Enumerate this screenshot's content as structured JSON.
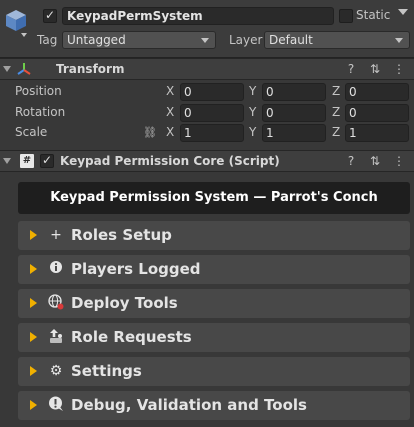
{
  "header": {
    "object_name": "KeypadPermSystem",
    "active": true,
    "static_label": "Static",
    "tag_label": "Tag",
    "tag_value": "Untagged",
    "layer_label": "Layer",
    "layer_value": "Default"
  },
  "transform": {
    "title": "Transform",
    "rows": [
      {
        "label": "Position",
        "x": "0",
        "y": "0",
        "z": "0"
      },
      {
        "label": "Rotation",
        "x": "0",
        "y": "0",
        "z": "0"
      },
      {
        "label": "Scale",
        "x": "1",
        "y": "1",
        "z": "1"
      }
    ],
    "axis_x": "X",
    "axis_y": "Y",
    "axis_z": "Z"
  },
  "script": {
    "title": "Keypad Permission Core (Script)",
    "enabled": true,
    "banner": "Keypad Permission System  —  Parrot's Conch",
    "sections": [
      {
        "label": "Roles Setup",
        "icon": "plus-icon"
      },
      {
        "label": "Players Logged",
        "icon": "info-icon"
      },
      {
        "label": "Deploy Tools",
        "icon": "globe-icon"
      },
      {
        "label": "Role Requests",
        "icon": "upload-icon"
      },
      {
        "label": "Settings",
        "icon": "gear-icon"
      },
      {
        "label": "Debug, Validation and Tools",
        "icon": "alert-icon"
      }
    ]
  },
  "colors": {
    "accent_arrow": "#f0b000",
    "banner_bg": "#1e1e1e",
    "section_bg": "#484848"
  }
}
